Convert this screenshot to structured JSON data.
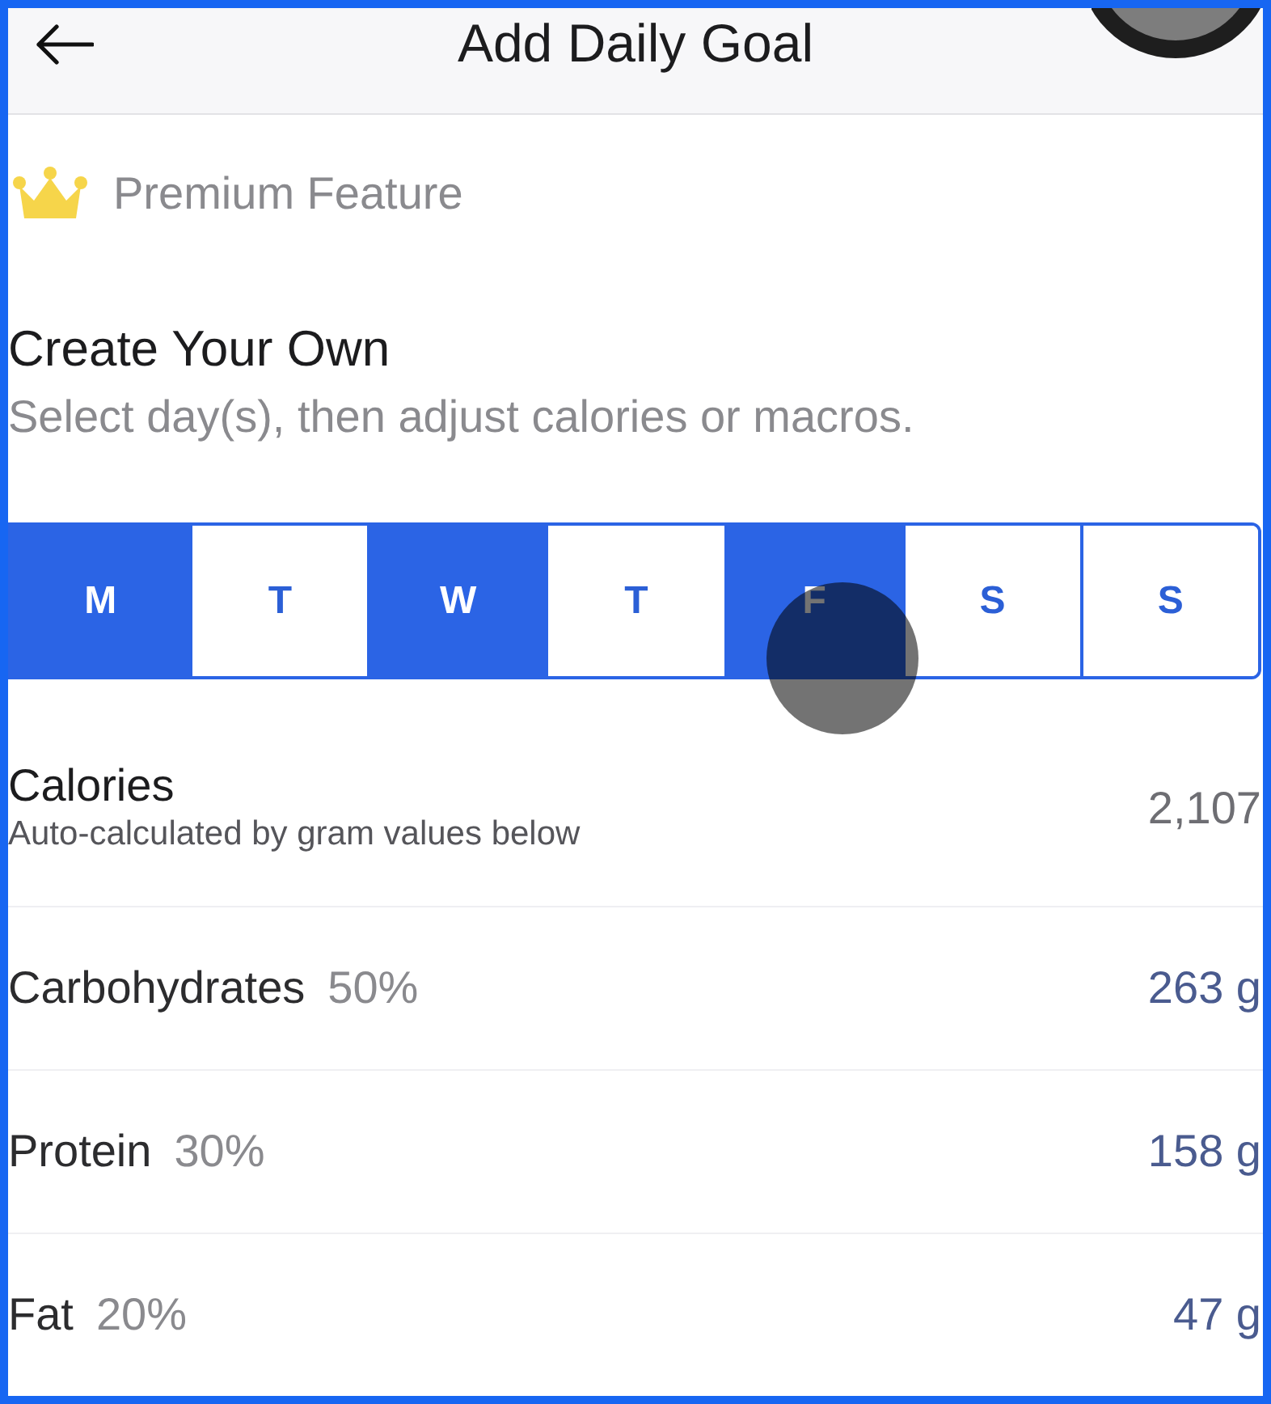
{
  "header": {
    "title": "Add Daily Goal"
  },
  "premium": {
    "label": "Premium Feature"
  },
  "section": {
    "title": "Create Your Own",
    "subtitle": "Select day(s), then adjust calories or macros."
  },
  "days": [
    {
      "label": "M",
      "selected": true
    },
    {
      "label": "T",
      "selected": false
    },
    {
      "label": "W",
      "selected": true
    },
    {
      "label": "T",
      "selected": false
    },
    {
      "label": "F",
      "selected": true
    },
    {
      "label": "S",
      "selected": false
    },
    {
      "label": "S",
      "selected": false
    }
  ],
  "calories": {
    "label": "Calories",
    "note": "Auto-calculated by gram values below",
    "value": "2,107"
  },
  "macros": [
    {
      "name": "Carbohydrates",
      "percent": "50%",
      "value": "263 g"
    },
    {
      "name": "Protein",
      "percent": "30%",
      "value": "158 g"
    },
    {
      "name": "Fat",
      "percent": "20%",
      "value": "47 g"
    }
  ]
}
